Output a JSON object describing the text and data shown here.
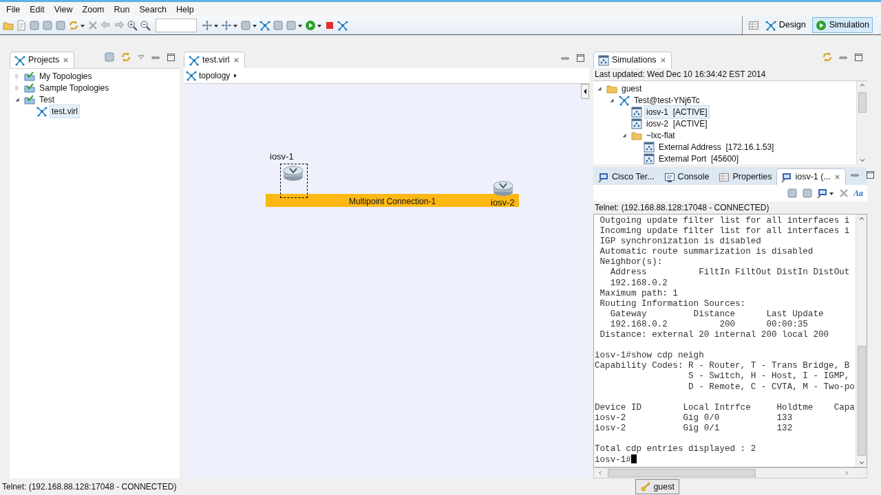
{
  "menu": [
    "File",
    "Edit",
    "View",
    "Zoom",
    "Run",
    "Search",
    "Help"
  ],
  "perspectives": [
    {
      "label": "Design",
      "selected": false
    },
    {
      "label": "Simulation",
      "selected": true
    }
  ],
  "projects": {
    "tab": "Projects",
    "tree": [
      {
        "label": "My Topologies",
        "kind": "folder",
        "expanded": false,
        "selected": false
      },
      {
        "label": "Sample Topologies",
        "kind": "folder",
        "expanded": false,
        "selected": false
      },
      {
        "label": "Test",
        "kind": "folder",
        "expanded": true,
        "selected": false,
        "children": [
          {
            "label": "test.virl",
            "kind": "topology",
            "selected": true
          }
        ]
      }
    ]
  },
  "editor": {
    "tab": "test.virl",
    "breadcrumb": "topology",
    "connection": "Multipoint Connection-1",
    "nodes": [
      {
        "label": "iosv-1",
        "selected": true
      },
      {
        "label": "iosv-2",
        "selected": false
      }
    ]
  },
  "simulations": {
    "tab": "Simulations",
    "last_updated": "Last updated: Wed Dec 10 16:34:42 EST 2014",
    "tree": [
      {
        "label": "guest",
        "kind": "folder",
        "expanded": true,
        "selected": false,
        "children": [
          {
            "label": "Test@test-YNj6Tc",
            "kind": "topology",
            "expanded": true,
            "selected": false,
            "children": [
              {
                "label": "iosv-1  [ACTIVE]",
                "kind": "node",
                "selected": true
              },
              {
                "label": "iosv-2  [ACTIVE]",
                "kind": "node",
                "selected": false
              },
              {
                "label": "~lxc-flat",
                "kind": "folder",
                "expanded": true,
                "selected": false,
                "children": [
                  {
                    "label": "External Address  [172.16.1.53]",
                    "kind": "node",
                    "selected": false
                  },
                  {
                    "label": "External Port  [45600]",
                    "kind": "node",
                    "selected": false
                  }
                ]
              }
            ]
          }
        ]
      }
    ]
  },
  "console_tabs": [
    {
      "label": "Cisco Ter...",
      "kind": "terminal",
      "selected": false
    },
    {
      "label": "Console",
      "kind": "console",
      "selected": false
    },
    {
      "label": "Properties",
      "kind": "properties",
      "selected": false
    },
    {
      "label": "iosv-1 (...",
      "kind": "terminal",
      "selected": true
    }
  ],
  "font_button": "Aa",
  "telnet_status": "Telnet: (192.168.88.128:17048 - CONNECTED)",
  "terminal": [
    [
      " Outgoing update filter list for all interfaces i",
      " Incoming update filter list for all interfaces i",
      " IGP synchronization is disabled",
      " Automatic route summarization is disabled",
      " Neighbor(s):",
      "   Address          FiltIn FiltOut DistIn DistOut",
      "   192.168.0.2",
      " Maximum path: 1",
      " Routing Information Sources:",
      "   Gateway         Distance      Last Update",
      "   192.168.0.2          200      00:00:35",
      " Distance: external 20 internal 200 local 200"
    ],
    [
      "iosv-1#show cdp neigh",
      "Capability Codes: R - Router, T - Trans Bridge, B",
      "                  S - Switch, H - Host, I - IGMP,",
      "                  D - Remote, C - CVTA, M - Two-po"
    ],
    [
      "Device ID        Local Intrfce     Holdtme    Capa",
      "iosv-2           Gig 0/0           133",
      "iosv-2           Gig 0/1           132"
    ],
    [
      "Total cdp entries displayed : 2",
      "iosv-1#"
    ]
  ],
  "status_bar": "Telnet: (192.168.88.128:17048 - CONNECTED)",
  "user": "guest"
}
